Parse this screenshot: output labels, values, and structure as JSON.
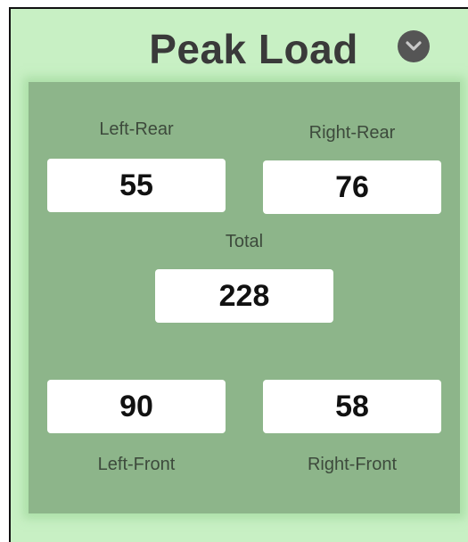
{
  "header": {
    "title": "Peak Load",
    "dropdown_icon": "chevron-down-icon"
  },
  "panel": {
    "left_rear": {
      "label": "Left-Rear",
      "value": "55"
    },
    "right_rear": {
      "label": "Right-Rear",
      "value": "76"
    },
    "total": {
      "label": "Total",
      "value": "228"
    },
    "left_front": {
      "label": "Left-Front",
      "value": "90"
    },
    "right_front": {
      "label": "Right-Front",
      "value": "58"
    }
  },
  "colors": {
    "background": "#c8f0c4",
    "panel": "#8db58a",
    "title": "#3a3a3a",
    "value_box": "#ffffff"
  }
}
